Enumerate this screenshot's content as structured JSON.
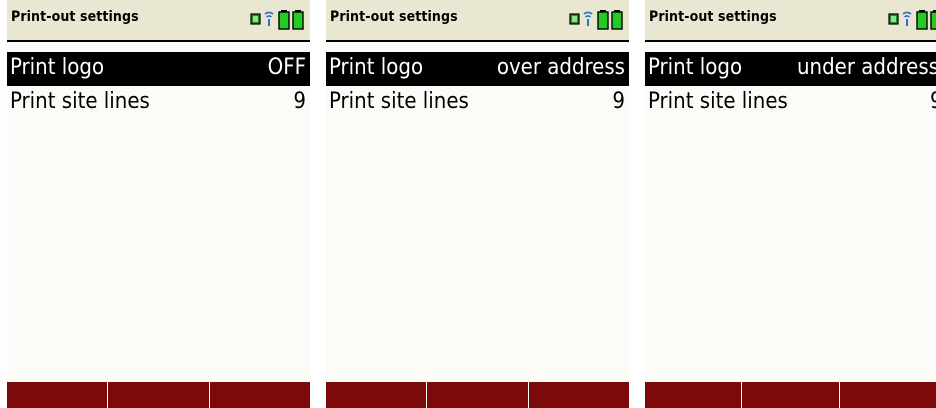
{
  "screens": [
    {
      "title": "Print-out settings",
      "rows": [
        {
          "label": "Print logo",
          "value": "OFF",
          "selected": true
        },
        {
          "label": "Print site lines",
          "value": "9",
          "selected": false
        }
      ]
    },
    {
      "title": "Print-out settings",
      "rows": [
        {
          "label": "Print logo",
          "value": "over address",
          "selected": true
        },
        {
          "label": "Print site lines",
          "value": "9",
          "selected": false
        }
      ]
    },
    {
      "title": "Print-out settings",
      "rows": [
        {
          "label": "Print logo",
          "value": "under address",
          "selected": true
        },
        {
          "label": "Print site lines",
          "value": "9",
          "selected": false
        }
      ]
    }
  ],
  "colors": {
    "header_bg": "#e9e6d2",
    "screen_bg": "#fbfbf7",
    "selected_bg": "#000000",
    "softkey_bg": "#7d0a0a",
    "battery": "#22cc22",
    "wireless": "#2f6fd0"
  },
  "icons": [
    "device-icon",
    "wireless-signal-icon",
    "battery-icon",
    "battery-icon"
  ]
}
